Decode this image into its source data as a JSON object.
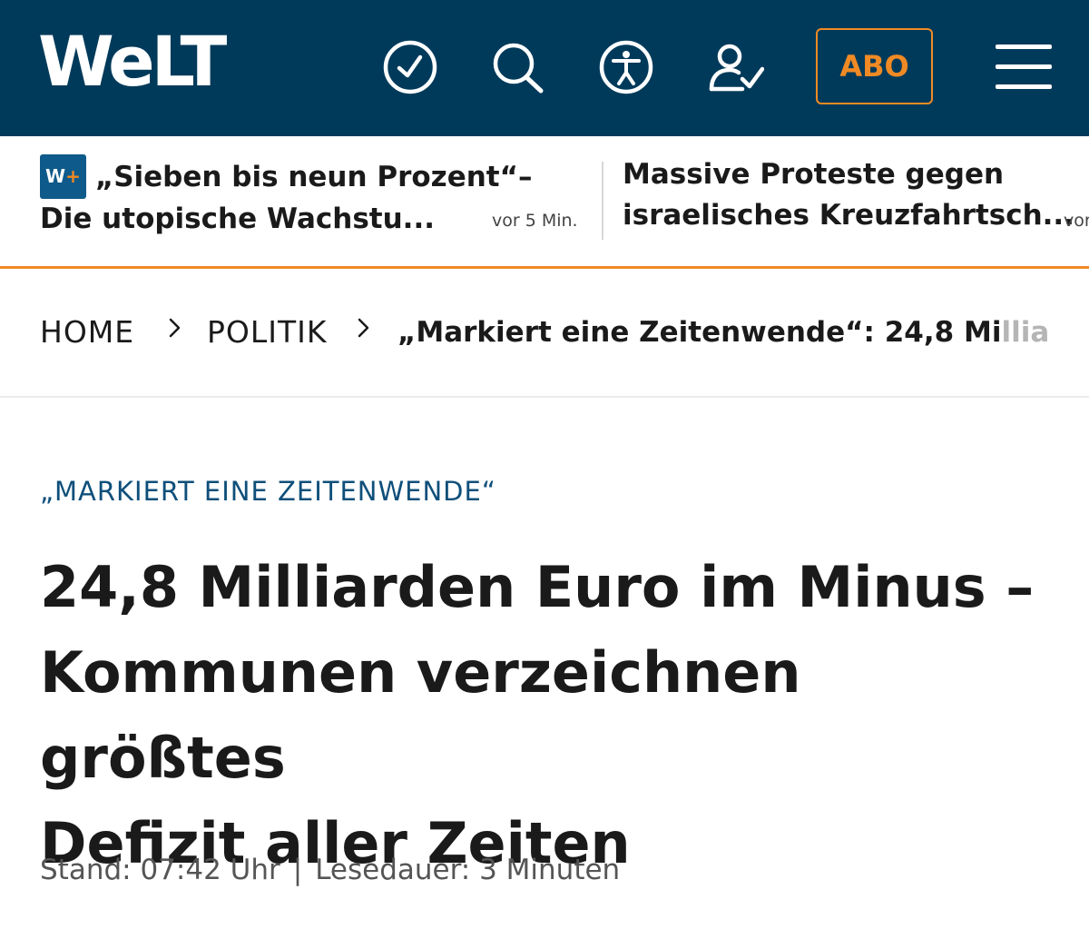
{
  "header": {
    "logo": "WeLT",
    "icons": [
      "clock-icon",
      "search-icon",
      "accessibility-icon",
      "login-icon"
    ],
    "abo_label": "ABO",
    "colors": {
      "background": "#003a5a",
      "accent": "#f08a24"
    }
  },
  "ticker": {
    "items": [
      {
        "badge": "W+",
        "title_line1": "„Sieben bis neun Prozent“–",
        "title_line2": "Die utopische Wachstu...",
        "time": "vor 5 Min."
      },
      {
        "title_line1": "Massive Proteste gegen",
        "title_line2": "israelisches Kreuzfahrtsch...",
        "time": "vor"
      }
    ]
  },
  "breadcrumb": {
    "home": "HOME",
    "section": "POLITIK",
    "current_main": "„Markiert eine Zeitenwende“: 24,8 Mi",
    "current_fade": "llia"
  },
  "article": {
    "kicker": "„MARKIERT EINE ZEITENWENDE“",
    "headline_line1": "24,8 Milliarden Euro im Minus –",
    "headline_line2": "Kommunen verzeichnen größtes",
    "headline_line3": "Defizit aller Zeiten",
    "stand": "Stand: 07:42 Uhr",
    "separator": "|",
    "reading_time": "Lesedauer: 3 Minuten"
  }
}
